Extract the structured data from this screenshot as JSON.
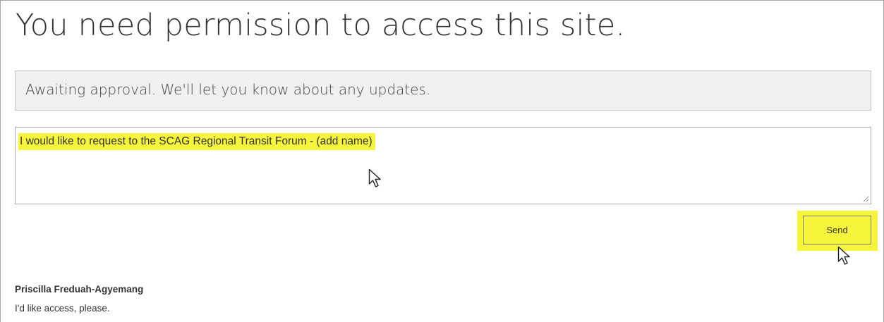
{
  "page": {
    "title": "You need permission to access this site."
  },
  "status": {
    "text": "Awaiting approval. We'll let you know about any updates."
  },
  "request_form": {
    "message_value": "I would like to request to the SCAG Regional Transit Forum - (add name)",
    "send_label": "Send"
  },
  "history": {
    "requester_name": "Priscilla Freduah-Agyemang",
    "requester_message": "I'd like access, please."
  },
  "colors": {
    "highlight": "#f5f53c",
    "banner_background": "#f0f0f0",
    "text": "#333333"
  },
  "icons": {
    "pointer": "arrow-cursor-icon",
    "resize": "resize-grip-icon"
  }
}
